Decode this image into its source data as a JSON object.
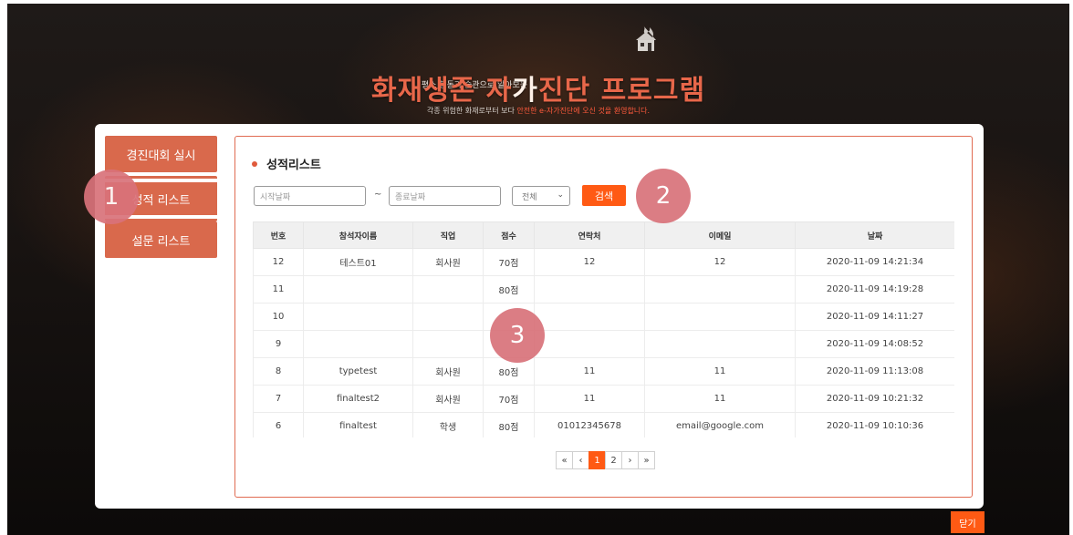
{
  "header": {
    "subtitle": "평소 행동과 습관으로 알아보는",
    "title_part1": "화재생존 자",
    "title_part2": "가",
    "title_part3": "진단 프로그램",
    "tag_part1": "각종 위험한 화재로부터 보다 ",
    "tag_part2": "안전한 e-자가진단에 오신 것을 환영합니다.",
    "icon": "burning-house-icon"
  },
  "sidebar": {
    "items": [
      {
        "label": "경진대회 실시"
      },
      {
        "label": "성적 리스트"
      },
      {
        "label": "설문 리스트"
      }
    ]
  },
  "main": {
    "section_title": "성적리스트",
    "start_date_placeholder": "시작날짜",
    "tilde": "~",
    "end_date_placeholder": "종료날짜",
    "filter_selected": "전체",
    "search_label": "검색",
    "columns": [
      "번호",
      "참석자이름",
      "직업",
      "점수",
      "연락처",
      "이메일",
      "날짜"
    ],
    "rows": [
      [
        "12",
        "테스트01",
        "회사원",
        "70점",
        "12",
        "12",
        "2020-11-09 14:21:34"
      ],
      [
        "11",
        "",
        "",
        "80점",
        "",
        "",
        "2020-11-09 14:19:28"
      ],
      [
        "10",
        "",
        "",
        "",
        "",
        "",
        "2020-11-09 14:11:27"
      ],
      [
        "9",
        "",
        "",
        "",
        "",
        "",
        "2020-11-09 14:08:52"
      ],
      [
        "8",
        "typetest",
        "회사원",
        "80점",
        "11",
        "11",
        "2020-11-09 11:13:08"
      ],
      [
        "7",
        "finaltest2",
        "회사원",
        "70점",
        "11",
        "11",
        "2020-11-09 10:21:32"
      ],
      [
        "6",
        "finaltest",
        "학생",
        "80점",
        "01012345678",
        "email@google.com",
        "2020-11-09 10:10:36"
      ]
    ],
    "pagination": {
      "first": "«",
      "prev": "‹",
      "pages": [
        "1",
        "2"
      ],
      "current": "1",
      "next": "›",
      "last": "»"
    }
  },
  "annotations": [
    "1",
    "2",
    "3"
  ],
  "close_label": "닫기",
  "colors": {
    "accent": "#ff5a14",
    "sidebar": "#d9694c",
    "badge": "#d9727a",
    "title": "#e8674a"
  }
}
